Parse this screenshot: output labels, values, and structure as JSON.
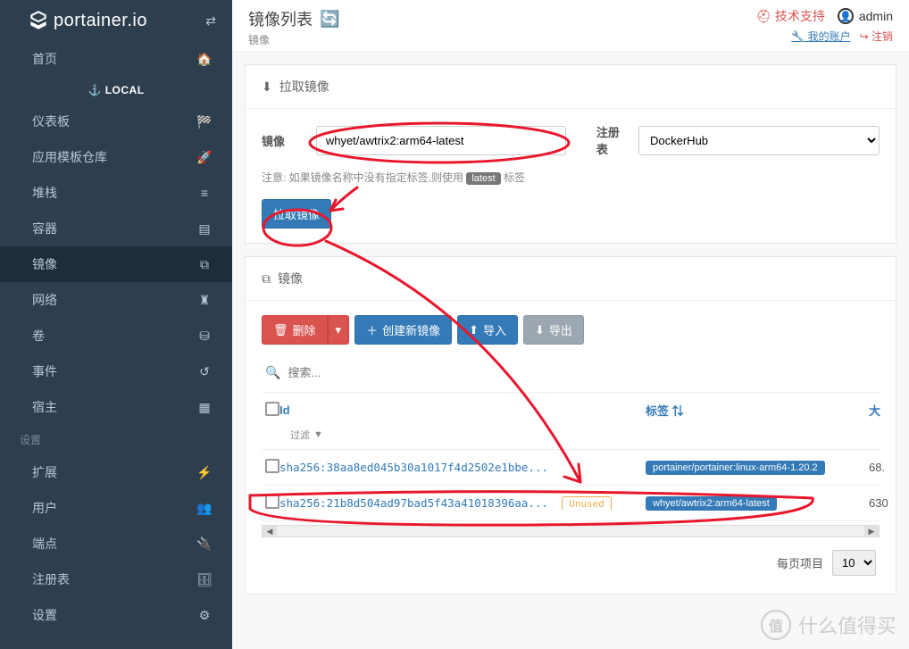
{
  "brand": "portainer.io",
  "sidebar": {
    "section": "⚓ LOCAL",
    "home": "首页",
    "items": [
      {
        "label": "仪表板",
        "icon": "tachometer"
      },
      {
        "label": "应用模板仓库",
        "icon": "rocket"
      },
      {
        "label": "堆栈",
        "icon": "list"
      },
      {
        "label": "容器",
        "icon": "server"
      },
      {
        "label": "镜像",
        "icon": "copy"
      },
      {
        "label": "网络",
        "icon": "sitemap"
      },
      {
        "label": "卷",
        "icon": "hdd"
      },
      {
        "label": "事件",
        "icon": "history"
      },
      {
        "label": "宿主",
        "icon": "th"
      }
    ],
    "settings_label": "设置",
    "settings": [
      {
        "label": "扩展",
        "icon": "bolt"
      },
      {
        "label": "用户",
        "icon": "users"
      },
      {
        "label": "端点",
        "icon": "plug"
      },
      {
        "label": "注册表",
        "icon": "database"
      },
      {
        "label": "设置",
        "icon": "cogs"
      }
    ]
  },
  "header": {
    "title": "镜像列表",
    "breadcrumb": "镜像",
    "tech_support": "技术支持",
    "user": "admin",
    "my_account": "我的账户",
    "logout": "注销"
  },
  "pull": {
    "panel_title": "拉取镜像",
    "image_label": "镜像",
    "image_value": "whyet/awtrix2:arm64-latest",
    "registry_label": "注册表",
    "registry_value": "DockerHub",
    "note_prefix": "注意: 如果镜像名称中没有指定标签,则使用",
    "note_badge": "latest",
    "note_suffix": "标签",
    "pull_button": "拉取镜像"
  },
  "images": {
    "panel_title": "镜像",
    "delete": "删除",
    "create": "创建新镜像",
    "import": "导入",
    "export": "导出",
    "search_placeholder": "搜索...",
    "col_id": "Id",
    "col_tags": "标签",
    "col_size": "大",
    "filter_label": "过滤",
    "unused_label": "Unused",
    "rows": [
      {
        "id": "sha256:38aa8ed045b30a1017f4d2502e1bbe...",
        "tags": [
          "portainer/portainer:linux-arm64-1.20.2"
        ],
        "size": "68.",
        "unused": false
      },
      {
        "id": "sha256:21b8d504ad97bad5f43a41018396aa...",
        "tags": [
          "whyet/awtrix2:arm64-latest"
        ],
        "size": "630",
        "unused": true
      }
    ],
    "per_page_label": "每页项目",
    "per_page_value": "10"
  },
  "watermark": "什么值得买"
}
